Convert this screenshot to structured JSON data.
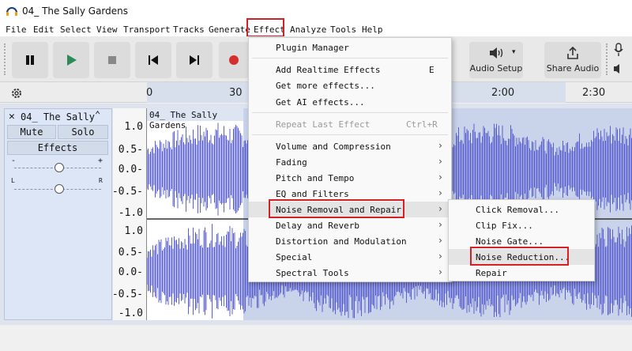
{
  "window": {
    "title": "04_ The Sally Gardens"
  },
  "menubar": {
    "items": [
      {
        "label": "File"
      },
      {
        "label": "Edit"
      },
      {
        "label": "Select"
      },
      {
        "label": "View"
      },
      {
        "label": "Transport"
      },
      {
        "label": "Tracks"
      },
      {
        "label": "Generate"
      },
      {
        "label": "Effect"
      },
      {
        "label": "Analyze"
      },
      {
        "label": "Tools"
      },
      {
        "label": "Help"
      }
    ]
  },
  "toolbar": {
    "audio_setup_label": "Audio Setup",
    "share_audio_label": "Share Audio"
  },
  "ruler": {
    "ticks": [
      "0",
      "30",
      "2:00",
      "2:30"
    ]
  },
  "track": {
    "name": "04_ The Sally",
    "mute_label": "Mute",
    "solo_label": "Solo",
    "effects_label": "Effects",
    "gain_minus": "-",
    "gain_plus": "+",
    "pan_left": "L",
    "pan_right": "R",
    "clip_name": "04_ The Sally Gardens",
    "amp_labels": [
      "1.0",
      "0.5-",
      "0.0-",
      "-0.5-",
      "-1.0"
    ]
  },
  "effect_menu": {
    "items": [
      {
        "label": "Plugin Manager"
      },
      {
        "label": "Add Realtime Effects",
        "shortcut": "E"
      },
      {
        "label": "Get more effects..."
      },
      {
        "label": "Get AI effects..."
      },
      {
        "label": "Repeat Last Effect",
        "shortcut": "Ctrl+R"
      },
      {
        "label": "Volume and Compression"
      },
      {
        "label": "Fading"
      },
      {
        "label": "Pitch and Tempo"
      },
      {
        "label": "EQ and Filters"
      },
      {
        "label": "Noise Removal and Repair"
      },
      {
        "label": "Delay and Reverb"
      },
      {
        "label": "Distortion and Modulation"
      },
      {
        "label": "Special"
      },
      {
        "label": "Spectral Tools"
      }
    ]
  },
  "noise_submenu": {
    "items": [
      {
        "label": "Click Removal..."
      },
      {
        "label": "Clip Fix..."
      },
      {
        "label": "Noise Gate..."
      },
      {
        "label": "Noise Reduction..."
      },
      {
        "label": "Repair"
      }
    ]
  },
  "colors": {
    "waveform": "#5a5fd0",
    "selection": "#c9d3ea",
    "highlight": "#d81f26",
    "record": "#d32f2f",
    "play": "#2e8b57"
  }
}
